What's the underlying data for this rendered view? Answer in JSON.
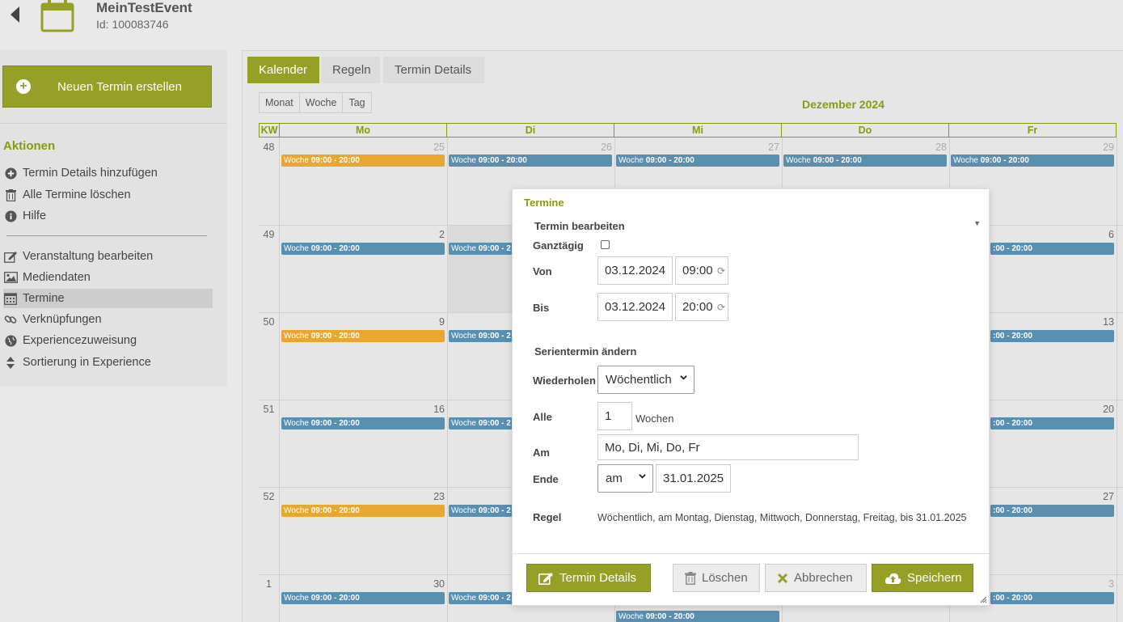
{
  "header": {
    "title": "MeinTestEvent",
    "id_text": "Id: 100083746"
  },
  "sidebar": {
    "new_button": "Neuen Termin erstellen",
    "section_title": "Aktionen",
    "actions": [
      {
        "label": "Termin Details hinzufügen",
        "icon": "plus-circle-icon"
      },
      {
        "label": "Alle Termine löschen",
        "icon": "trash-icon"
      },
      {
        "label": "Hilfe",
        "icon": "info-icon"
      }
    ],
    "nav": [
      {
        "label": "Veranstaltung bearbeiten",
        "icon": "edit-icon"
      },
      {
        "label": "Mediendaten",
        "icon": "image-icon"
      },
      {
        "label": "Termine",
        "icon": "calendar-icon",
        "active": true
      },
      {
        "label": "Verknüpfungen",
        "icon": "link-icon"
      },
      {
        "label": "Experiencezuweisung",
        "icon": "globe-icon"
      },
      {
        "label": "Sortierung in Experience",
        "icon": "sort-icon"
      }
    ]
  },
  "tabs": [
    "Kalender",
    "Regeln",
    "Termin Details"
  ],
  "view_buttons": [
    "Monat",
    "Woche",
    "Tag"
  ],
  "calendar": {
    "month_title": "Dezember 2024",
    "headers": [
      "KW",
      "Mo",
      "Di",
      "Mi",
      "Do",
      "Fr"
    ],
    "weeks": [
      {
        "kw": "48",
        "days": [
          "25",
          "26",
          "27",
          "28",
          "29"
        ]
      },
      {
        "kw": "49",
        "days": [
          "2",
          "",
          "",
          "",
          "6"
        ]
      },
      {
        "kw": "50",
        "days": [
          "9",
          "",
          "",
          "",
          "13"
        ]
      },
      {
        "kw": "51",
        "days": [
          "16",
          "",
          "",
          "",
          "20"
        ]
      },
      {
        "kw": "52",
        "days": [
          "23",
          "",
          "",
          "",
          "27"
        ]
      },
      {
        "kw": "1",
        "days": [
          "30",
          "",
          "",
          "",
          "3"
        ]
      }
    ],
    "event_prefix": "Woche",
    "event_time": "09:00 - 20:00",
    "event_time_partial_di": "09:00 - 2",
    "event_time_partial_fr": ":00 - 20:00"
  },
  "modal": {
    "title": "Termine",
    "section_edit": "Termin bearbeiten",
    "ganztaegig_label": "Ganztägig",
    "von_label": "Von",
    "von_date": "03.12.2024",
    "von_time": "09:00",
    "bis_label": "Bis",
    "bis_date": "03.12.2024",
    "bis_time": "20:00",
    "section_series": "Serientermin ändern",
    "wiederholen_label": "Wiederholen",
    "wiederholen_value": "Wöchentlich",
    "alle_label": "Alle",
    "alle_value": "1",
    "alle_unit": "Wochen",
    "am_label": "Am",
    "am_value": "Mo, Di, Mi, Do, Fr",
    "ende_label": "Ende",
    "ende_select": "am",
    "ende_date": "31.01.2025",
    "regel_label": "Regel",
    "regel_text": "Wöchentlich, am Montag, Dienstag, Mittwoch, Donnerstag, Freitag, bis 31.01.2025",
    "btn_details": "Termin Details",
    "btn_delete": "Löschen",
    "btn_cancel": "Abbrechen",
    "btn_save": "Speichern"
  },
  "colors": {
    "accent": "#96a026",
    "event_orange": "#e8a730",
    "event_blue": "#5a8fb0"
  }
}
